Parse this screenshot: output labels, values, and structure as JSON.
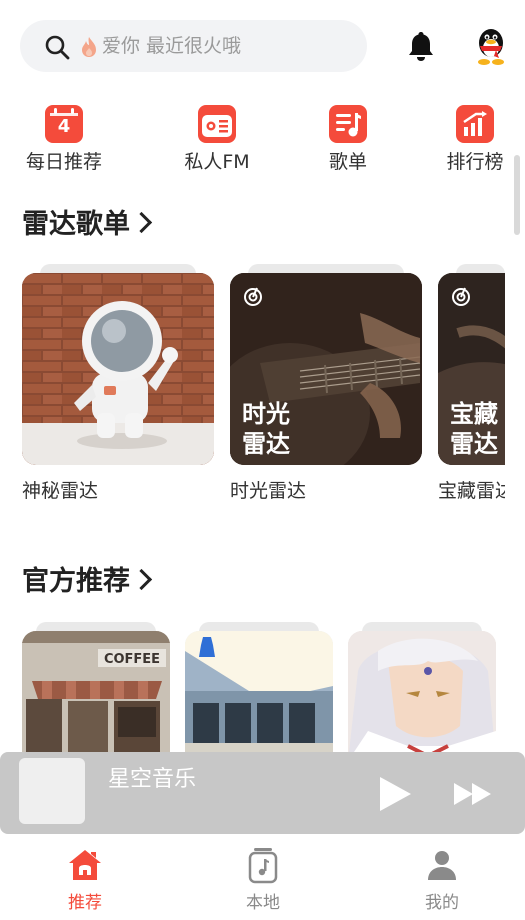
{
  "search": {
    "placeholder": "爱你 最近很火哦"
  },
  "quick_entries": [
    {
      "label": "每日推荐",
      "icon": "calendar-icon",
      "badge": "4"
    },
    {
      "label": "私人FM",
      "icon": "radio-icon"
    },
    {
      "label": "歌单",
      "icon": "playlist-icon"
    },
    {
      "label": "排行榜",
      "icon": "chart-icon"
    }
  ],
  "radar": {
    "title": "雷达歌单",
    "cards": [
      {
        "label": "神秘雷达",
        "overlay": ""
      },
      {
        "label": "时光雷达",
        "overlay_line1": "时光",
        "overlay_line2": "雷达"
      },
      {
        "label": "宝藏雷达",
        "overlay_line1": "宝藏",
        "overlay_line2": "雷达"
      }
    ]
  },
  "official": {
    "title": "官方推荐",
    "cards": [
      {
        "label": "",
        "sign_text": "COFFEE"
      },
      {
        "label": ""
      },
      {
        "label": ""
      }
    ]
  },
  "player": {
    "title": "星空音乐"
  },
  "tabs": [
    {
      "label": "推荐",
      "icon": "home-icon",
      "active": true
    },
    {
      "label": "本地",
      "icon": "music-file-icon",
      "active": false
    },
    {
      "label": "我的",
      "icon": "user-icon",
      "active": false
    }
  ],
  "colors": {
    "accent": "#f44b3b",
    "inactive": "#8a8a8a"
  }
}
